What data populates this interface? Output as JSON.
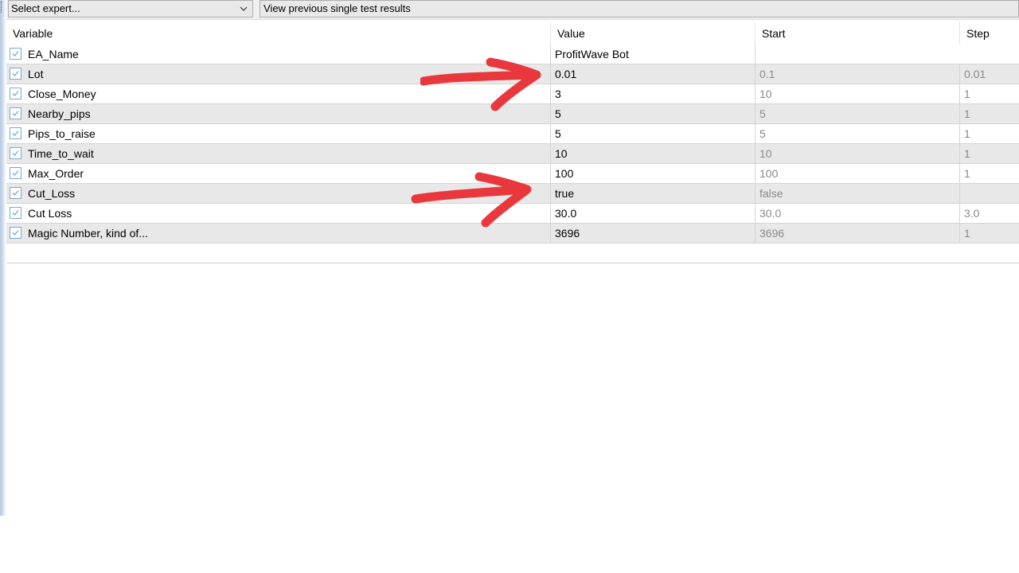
{
  "toolbar": {
    "expert_select": "Select expert...",
    "view_results": "View previous single test results"
  },
  "columns": {
    "variable": "Variable",
    "value": "Value",
    "start": "Start",
    "step": "Step"
  },
  "rows": [
    {
      "name": "EA_Name",
      "value": "ProfitWave Bot",
      "start": "",
      "step": "",
      "checked": true
    },
    {
      "name": "Lot",
      "value": "0.01",
      "start": "0.1",
      "step": "0.01",
      "checked": true
    },
    {
      "name": "Close_Money",
      "value": "3",
      "start": "10",
      "step": "1",
      "checked": true
    },
    {
      "name": "Nearby_pips",
      "value": "5",
      "start": "5",
      "step": "1",
      "checked": true
    },
    {
      "name": "Pips_to_raise",
      "value": "5",
      "start": "5",
      "step": "1",
      "checked": true
    },
    {
      "name": "Time_to_wait",
      "value": "10",
      "start": "10",
      "step": "1",
      "checked": true
    },
    {
      "name": "Max_Order",
      "value": "100",
      "start": "100",
      "step": "1",
      "checked": true
    },
    {
      "name": "Cut_Loss",
      "value": "true",
      "start": "false",
      "step": "",
      "checked": true
    },
    {
      "name": "Cut Loss",
      "value": "30.0",
      "start": "30.0",
      "step": "3.0",
      "checked": true
    },
    {
      "name": "Magic Number, kind of...",
      "value": "3696",
      "start": "3696",
      "step": "1",
      "checked": true
    }
  ],
  "colors": {
    "annotation_arrow": "#e8383d",
    "checkbox_border": "#7aa7d6",
    "row_shade": "#e8e8e8"
  }
}
